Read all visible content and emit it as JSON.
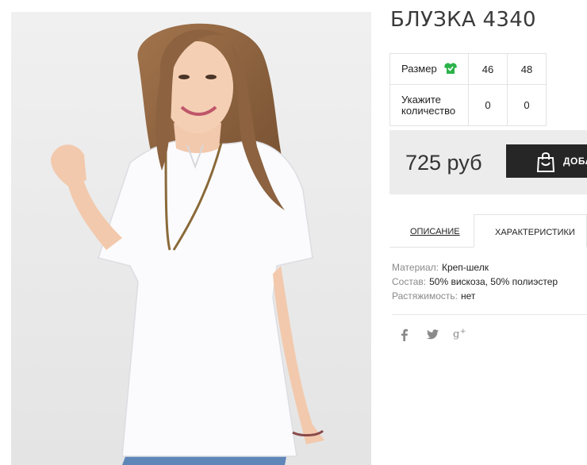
{
  "product": {
    "title": "БЛУЗКА 4340",
    "photo_icon": "model-photo"
  },
  "sizes": {
    "size_label": "Размер",
    "qty_label": "Укажите количество",
    "size_icon": "shirt-icon",
    "columns": [
      {
        "size": "46",
        "qty": "0"
      },
      {
        "size": "48",
        "qty": "0"
      }
    ]
  },
  "purchase": {
    "price": "725 руб",
    "button_label": "ДОБАВИТЬ",
    "button_icon": "shopping-bag-icon"
  },
  "tabs": [
    {
      "label": "ОПИСАНИЕ",
      "active": false
    },
    {
      "label": "ХАРАКТЕРИСТИКИ",
      "active": true
    }
  ],
  "properties": [
    {
      "key": "Материал:",
      "value": "Креп-шелк"
    },
    {
      "key": "Состав:",
      "value": "50% вискоза, 50% полиэстер"
    },
    {
      "key": "Растяжимость:",
      "value": "нет"
    }
  ],
  "social": [
    {
      "icon": "facebook-icon",
      "glyph": "f"
    },
    {
      "icon": "twitter-icon",
      "glyph": "🐦"
    },
    {
      "icon": "google-plus-icon",
      "glyph": "g+"
    }
  ],
  "colors": {
    "accent_green": "#2bb34a",
    "button_bg": "#262626",
    "price_bg": "#ececec"
  }
}
